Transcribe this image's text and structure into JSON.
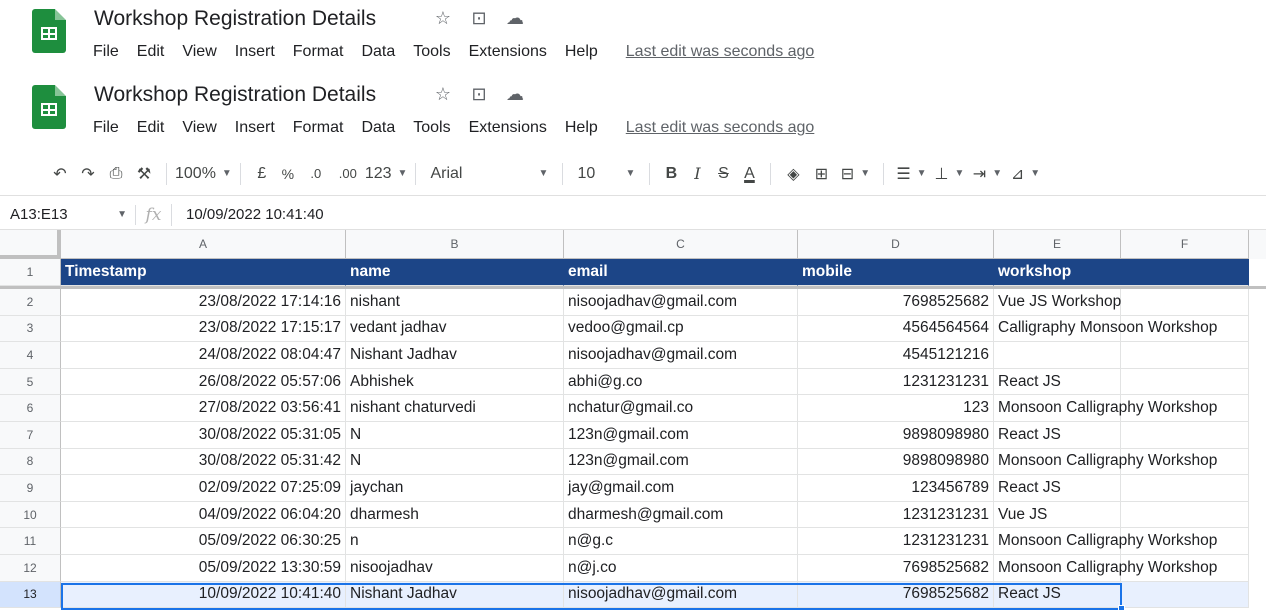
{
  "app": {
    "title": "Workshop Registration Details",
    "menu": [
      "File",
      "Edit",
      "View",
      "Insert",
      "Format",
      "Data",
      "Tools",
      "Extensions",
      "Help"
    ],
    "last_edit": "Last edit was seconds ago",
    "brand_color": "#1e8e3e"
  },
  "toolbar": {
    "zoom": "100%",
    "currency": "£",
    "percent": "%",
    "dec_decrease": ".0",
    "dec_increase": ".00",
    "format_more": "123",
    "font": "Arial",
    "font_size": "10",
    "bold": "B",
    "italic": "I",
    "strike": "S",
    "text_color": "A",
    "icons": [
      "undo-icon",
      "redo-icon",
      "print-icon",
      "paint-format-icon",
      "fill-color-icon",
      "borders-icon",
      "merge-icon",
      "align-icon",
      "valign-icon",
      "wrap-icon",
      "rotate-icon"
    ]
  },
  "formula_bar": {
    "name_box": "A13:E13",
    "fx": "fx",
    "value": "10/09/2022 10:41:40"
  },
  "columns": [
    "A",
    "B",
    "C",
    "D",
    "E",
    "F"
  ],
  "header_color": "#1c4587",
  "selection_color": "#1a73e8",
  "table": {
    "headers": [
      "Timestamp",
      "name",
      "email",
      "mobile",
      "workshop"
    ],
    "rows": [
      {
        "n": "2",
        "cells": [
          "23/08/2022 17:14:16",
          "nishant",
          "nisoojadhav@gmail.com",
          "7698525682",
          "Vue JS Workshop"
        ]
      },
      {
        "n": "3",
        "cells": [
          "23/08/2022 17:15:17",
          "vedant jadhav",
          "vedoo@gmail.cp",
          "4564564564",
          "Calligraphy Monsoon Workshop"
        ]
      },
      {
        "n": "4",
        "cells": [
          "24/08/2022 08:04:47",
          "Nishant Jadhav",
          "nisoojadhav@gmail.com",
          "4545121216",
          ""
        ]
      },
      {
        "n": "5",
        "cells": [
          "26/08/2022 05:57:06",
          "Abhishek",
          "abhi@g.co",
          "1231231231",
          "React JS"
        ]
      },
      {
        "n": "6",
        "cells": [
          "27/08/2022 03:56:41",
          "nishant chaturvedi",
          "nchatur@gmail.co",
          "123",
          "Monsoon Calligraphy Workshop"
        ]
      },
      {
        "n": "7",
        "cells": [
          "30/08/2022 05:31:05",
          "N",
          "123n@gmail.com",
          "9898098980",
          "React JS"
        ]
      },
      {
        "n": "8",
        "cells": [
          "30/08/2022 05:31:42",
          "N",
          "123n@gmail.com",
          "9898098980",
          "Monsoon Calligraphy Workshop"
        ]
      },
      {
        "n": "9",
        "cells": [
          "02/09/2022 07:25:09",
          "jaychan",
          "jay@gmail.com",
          "123456789",
          "React JS"
        ]
      },
      {
        "n": "10",
        "cells": [
          "04/09/2022 06:04:20",
          "dharmesh",
          "dharmesh@gmail.com",
          "1231231231",
          "Vue JS"
        ]
      },
      {
        "n": "11",
        "cells": [
          "05/09/2022 06:30:25",
          "n",
          "n@g.c",
          "1231231231",
          "Monsoon Calligraphy Workshop"
        ]
      },
      {
        "n": "12",
        "cells": [
          "05/09/2022 13:30:59",
          "nisoojadhav",
          "n@j.co",
          "7698525682",
          "Monsoon Calligraphy Workshop"
        ]
      },
      {
        "n": "13",
        "cells": [
          "10/09/2022 10:41:40",
          "Nishant Jadhav",
          "nisoojadhav@gmail.com",
          "7698525682",
          "React JS"
        ]
      }
    ]
  }
}
